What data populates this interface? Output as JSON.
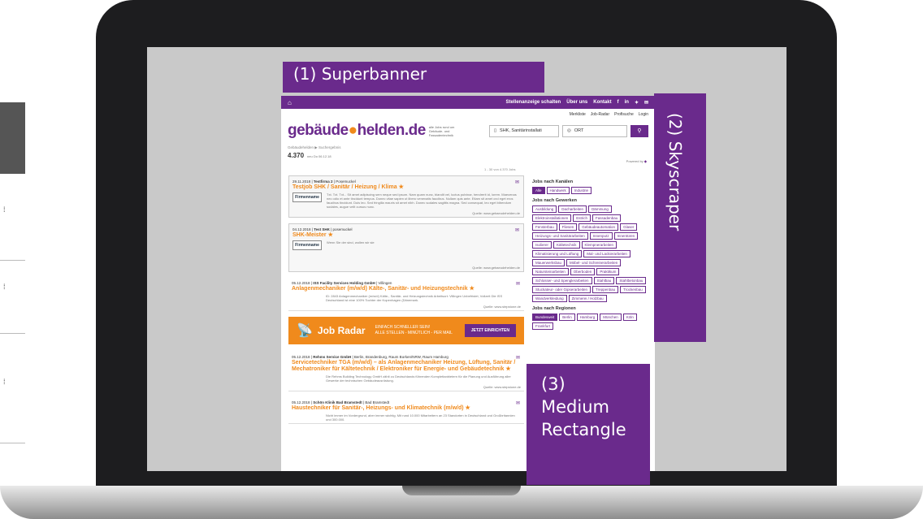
{
  "overlays": {
    "superbanner": "(1) Superbanner",
    "skyscraper": "(2) Skyscraper",
    "medium_rect_lines": [
      "(3)",
      "Medium",
      "Rectangle"
    ]
  },
  "topnav": {
    "links": [
      "Stellenanzeige schalten",
      "Über uns",
      "Kontakt"
    ],
    "social_icons": [
      "facebook-icon",
      "linkedin-icon",
      "twitter-icon",
      "mail-icon"
    ]
  },
  "util_links": [
    "Merkliste",
    "Job-Radar",
    "Profisuche",
    "Login"
  ],
  "header": {
    "logo_a": "gebäude",
    "logo_b": "helden",
    "logo_c": ".de",
    "tagline": "alle Jobs rund um Gebäude- und Fassadentechnik"
  },
  "search": {
    "keyword": "SHK, Sanitärinstallati",
    "location": "ORT"
  },
  "breadcrumb": "Gebäudehelden  ▶  Suchergebnis",
  "results": {
    "count": "4.370",
    "since": "neu Do 06.12.18",
    "paging": "1 - 30 von 4.370 Jobs",
    "powered": "Powered by"
  },
  "jobs": [
    {
      "date": "29.11.2018",
      "company": "Testfirma 2",
      "location": "Posemuckel",
      "title": "Testjob SHK / Sanitär / Heizung / Klima",
      "desc": "Txt. Txt. Txt... Sit amet adipiscing sem neque sed ipsum. Nam quam nunc, blandit vel, luctus pulvinar, hendrerit id, lorem. Maecenas nec odio et ante tincidunt tempus. Donec vitae sapien ut libero venenatis faucibus. Nullam quis ante. Etiam sit amet orci eget eros faucibus tincidunt. Duis leo. Sed fringilla mauris sit amet nibh. Donec sodales sagittis magna. Sed consequat, leo eget bibendum sodales, augue velit cursus nunc.",
      "source": "Quelle: www.gebaeudehelden.de",
      "logo": "Firmenname"
    },
    {
      "date": "04.12.2018",
      "company": "Test SHK",
      "location": "posemuckel",
      "title": "SHK-Meister",
      "desc": "Wenn Sie der sind, wollen wir sie",
      "source": "Quelle: www.gebaeudehelden.de",
      "logo": "Firmenname"
    },
    {
      "date": "05.12.2018",
      "company": "ISS Facility Services Holding GmbH",
      "location": "Villingen",
      "title": "Anlagenmechaniker (m/w/d) Kälte-, Sanitär- und Heizungstechnik",
      "desc": "ID: 2843 Anlagenmechaniker (m/w/d) Kälte-, Sanitär- und Heizungstechnik Arbeitsort: Villingen Unbefristet, Vollzeit Die ISS Deutschland ist eine 100% Tochter der Kopenhagen (Dänemark.",
      "source": "Quelle: www.stepstone.de"
    },
    {
      "date": "05.12.2018",
      "company": "Rehms Service GmbH",
      "location": "Berlin, Brandenburg, Raum Borken/NRW, Raum Hamburg",
      "title": "Servicetechniker TGA (m/w/d) – als Anlagenmechaniker Heizung, Lüftung, Sanitär / Mechatroniker für Kältetechnik / Elektroniker für Energie- und Gebäudetechnik",
      "desc": "Die Rehms Building Technology GmbH zählt zu Deutschlands führenden Komplettanbietern für die Planung und Ausführung aller Gewerke der technischen Gebäudeausrüstung.",
      "source": "Quelle: www.stepstone.de"
    },
    {
      "date": "05.12.2018",
      "company": "Schön Klinik Bad Bramstedt",
      "location": "Bad Bramstedt",
      "title": "Haustechniker für Sanitär-, Heizungs- und Klimatechnik (m/w/d)",
      "desc": "Nicht immer im Vordergrund, aber immer wichtig. Mit rund 10.000 Mitarbeitern an 23 Standorten in Deutschland und Großbritannien und 300.000.",
      "source": ""
    }
  ],
  "radar": {
    "title": "Job Radar",
    "line1": "EINFACH SCHNELLER SEIN!",
    "line2": "ALLE STELLEN - MINÜTLICH - PER MAIL",
    "button": "JETZT EINRICHTEN"
  },
  "sidebar": {
    "kanaele_title": "Jobs nach Kanälen",
    "kanaele": [
      "Alle",
      "Handwerk",
      "Industrie"
    ],
    "gewerke_title": "Jobs nach Gewerken",
    "gewerke": [
      "Ausbildung",
      "Dacharbeiten",
      "Dämmung",
      "Elektroinstallationen",
      "Estrich",
      "Fassadenbau",
      "Fensterbau",
      "Fliesen",
      "Gebäudeautomation",
      "Glaser",
      "Heizungs- und Sanitärarbeiten",
      "Innenputz",
      "Innentüren",
      "Isolierer",
      "Kältetechnik",
      "Klempnerarbeiten",
      "Klimatisierung und Lüftung",
      "Mal- und Lackierarbeiten",
      "Mauerwerksbau",
      "Möbel- und Schreinerarbeiten",
      "Natursteinarbeiten",
      "Oberboden",
      "Praktikum",
      "Schlosser- und Spenglerarbeiten",
      "Stahlbau",
      "Stahlbetonbau",
      "Stuckateur- oder Gipserarbeiten",
      "Treppenbau",
      "Trockenbau",
      "Wandverkleidung",
      "Zimmerei / Holzbau"
    ],
    "regionen_title": "Jobs nach Regionen",
    "regionen": [
      "Bundesweit",
      "Berlin",
      "Hamburg",
      "München",
      "Köln",
      "Frankfurt"
    ]
  }
}
